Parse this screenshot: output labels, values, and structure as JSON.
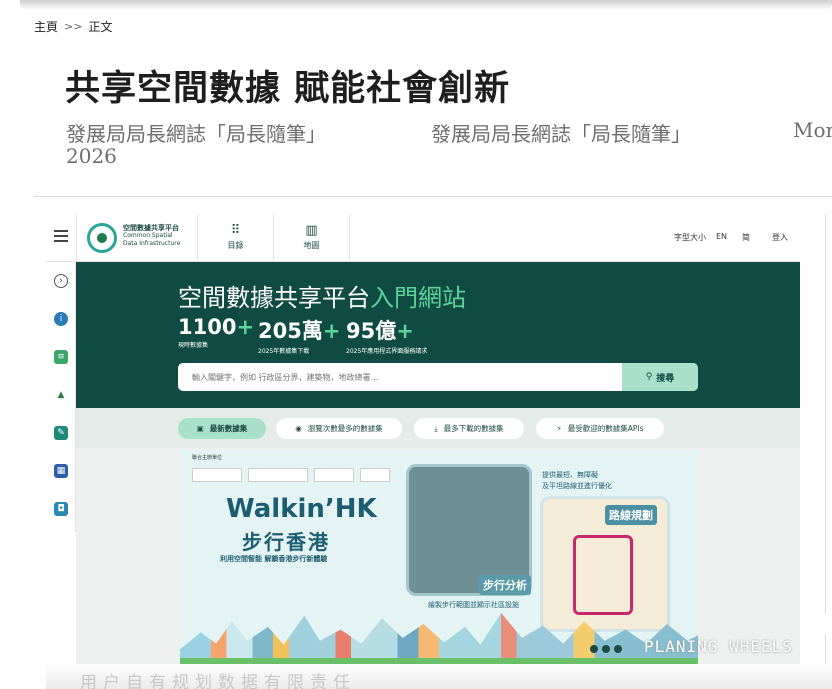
{
  "breadcrumb": {
    "home": "主頁",
    "separator": ">>",
    "current": "正文"
  },
  "article": {
    "title": "共享空間數據 賦能社會創新",
    "meta_1": "發展局局長網誌「局長隨筆」",
    "meta_2": "發展局局長網誌「局長隨筆」",
    "meta_3": "Mon",
    "year": "2026"
  },
  "site": {
    "logo_cn": "空間數據共享平台",
    "logo_en_1": "Common Spatial",
    "logo_en_2": "Data Infrastructure",
    "nav": [
      {
        "icon": "grid-icon",
        "label": "目錄"
      },
      {
        "icon": "map-icon",
        "label": "地圖"
      }
    ],
    "utils": {
      "font_size": "字型大小",
      "lang_en": "EN",
      "lang_sc": "简",
      "login": "登入"
    }
  },
  "hero": {
    "title_main": "空間數據共享平台",
    "title_accent": "入門網站",
    "stats": [
      {
        "value": "1100",
        "plus": "+",
        "caption": "現時數據集"
      },
      {
        "value": "205萬",
        "plus": "+",
        "caption": "2025年數據集下載"
      },
      {
        "value": "95億",
        "plus": "+",
        "caption": "2025年應用程式界面服務請求"
      }
    ],
    "search_placeholder": "輸入關鍵字，例如 行政區分界，建築物，地政總署…",
    "search_button": "搜尋"
  },
  "tabs": [
    {
      "label": "最新數據集",
      "active": true
    },
    {
      "label": "瀏覽次數最多的數據集",
      "active": false
    },
    {
      "label": "最多下載的數據集",
      "active": false
    },
    {
      "label": "最受歡迎的數據集APIs",
      "active": false
    }
  ],
  "banner": {
    "organiser": "聯合主辦單位",
    "walkin": "Walkin’HK",
    "walkin_cn": "步行香港",
    "subtitle": "利用空間智能 解鎖香港步行新體驗",
    "analysis": "步行分析",
    "analysis_caption": "繪製步行範圍並顯示社區設施",
    "route": "路線規劃",
    "route_caption_1": "提供最短、無障礙",
    "route_caption_2": "及平坦路線並進行優化"
  },
  "watermark": "PLANING WHEELS",
  "footer_text": "用户自有规划数据有限责任",
  "colors": {
    "hero": "#0f4b43",
    "accent": "#5bd39a",
    "pill_active": "#a8e0cc"
  }
}
